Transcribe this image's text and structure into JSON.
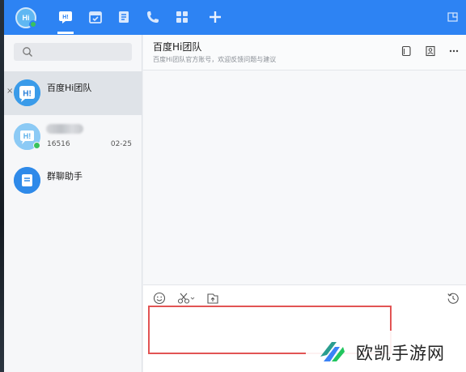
{
  "topbar": {
    "avatar_text": "Hi",
    "nav": [
      {
        "name": "chat",
        "active": true
      },
      {
        "name": "calendar"
      },
      {
        "name": "notes"
      },
      {
        "name": "phone"
      },
      {
        "name": "apps"
      },
      {
        "name": "add"
      }
    ]
  },
  "sidebar": {
    "search_placeholder": "",
    "conversations": [
      {
        "name": "百度Hi团队",
        "sub": "",
        "time": "",
        "active": true,
        "avatar_text": "Hi"
      },
      {
        "name": "",
        "sub": "16516",
        "time": "02-25",
        "active": false,
        "avatar_text": "Hi"
      },
      {
        "name": "群聊助手",
        "sub": "",
        "time": "",
        "active": false,
        "avatar_text": ""
      }
    ]
  },
  "chat": {
    "title": "百度Hi团队",
    "subtitle": "百度Hi团队官方账号，欢迎反馈问题与建议",
    "compose_placeholder": ""
  },
  "watermark": {
    "text": "欧凯手游网"
  },
  "colors": {
    "accent": "#2d83f3",
    "online": "#39c25c",
    "highlight": "#e25454"
  }
}
